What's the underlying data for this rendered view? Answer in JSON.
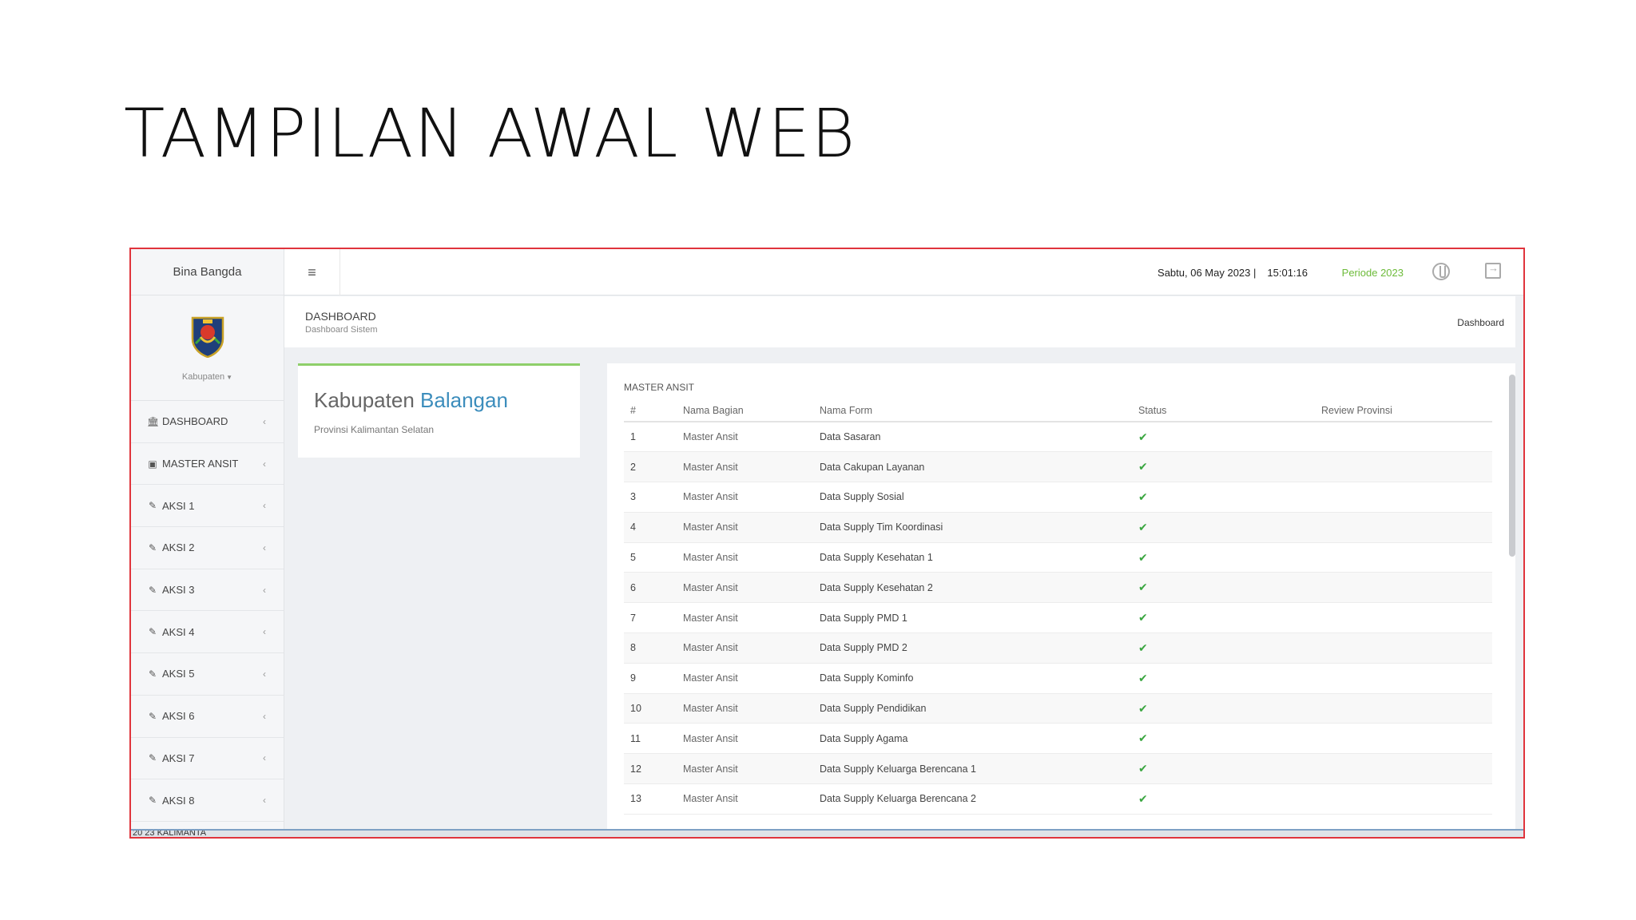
{
  "slide": {
    "title": "TAMPILAN AWAL WEB"
  },
  "sidebar": {
    "brand": "Bina Bangda",
    "profile_label": "Kabupaten",
    "items": [
      {
        "label": "DASHBOARD",
        "icon": "bank-icon"
      },
      {
        "label": "MASTER ANSIT",
        "icon": "book-icon"
      },
      {
        "label": "AKSI 1",
        "icon": "pencil-icon"
      },
      {
        "label": "AKSI 2",
        "icon": "pencil-icon"
      },
      {
        "label": "AKSI 3",
        "icon": "pencil-icon"
      },
      {
        "label": "AKSI 4",
        "icon": "pencil-icon"
      },
      {
        "label": "AKSI 5",
        "icon": "pencil-icon"
      },
      {
        "label": "AKSI 6",
        "icon": "pencil-icon"
      },
      {
        "label": "AKSI 7",
        "icon": "pencil-icon"
      },
      {
        "label": "AKSI 8",
        "icon": "pencil-icon"
      }
    ]
  },
  "topbar": {
    "date": "Sabtu, 06 May 2023 |",
    "time": "15:01:16",
    "periode": "Periode 2023",
    "periode_color": "#6dbb3a"
  },
  "pagehead": {
    "title": "DASHBOARD",
    "subtitle": "Dashboard Sistem",
    "breadcrumb": "Dashboard"
  },
  "kab_card": {
    "prefix": "Kabupaten",
    "highlight": "Balangan",
    "highlight_color": "#3c8dbc",
    "subtitle": "Provinsi Kalimantan Selatan"
  },
  "panel": {
    "title": "MASTER ANSIT",
    "headers": [
      "#",
      "Nama Bagian",
      "Nama Form",
      "Status",
      "Review Provinsi"
    ],
    "rows": [
      {
        "num": "1",
        "bagian": "Master Ansit",
        "form": "Data Sasaran",
        "status": "✔"
      },
      {
        "num": "2",
        "bagian": "Master Ansit",
        "form": "Data Cakupan Layanan",
        "status": "✔"
      },
      {
        "num": "3",
        "bagian": "Master Ansit",
        "form": "Data Supply Sosial",
        "status": "✔"
      },
      {
        "num": "4",
        "bagian": "Master Ansit",
        "form": "Data Supply Tim Koordinasi",
        "status": "✔"
      },
      {
        "num": "5",
        "bagian": "Master Ansit",
        "form": "Data Supply Kesehatan 1",
        "status": "✔"
      },
      {
        "num": "6",
        "bagian": "Master Ansit",
        "form": "Data Supply Kesehatan 2",
        "status": "✔"
      },
      {
        "num": "7",
        "bagian": "Master Ansit",
        "form": "Data Supply PMD 1",
        "status": "✔"
      },
      {
        "num": "8",
        "bagian": "Master Ansit",
        "form": "Data Supply PMD 2",
        "status": "✔"
      },
      {
        "num": "9",
        "bagian": "Master Ansit",
        "form": "Data Supply Kominfo",
        "status": "✔"
      },
      {
        "num": "10",
        "bagian": "Master Ansit",
        "form": "Data Supply Pendidikan",
        "status": "✔"
      },
      {
        "num": "11",
        "bagian": "Master Ansit",
        "form": "Data Supply Agama",
        "status": "✔"
      },
      {
        "num": "12",
        "bagian": "Master Ansit",
        "form": "Data Supply Keluarga Berencana 1",
        "status": "✔"
      },
      {
        "num": "13",
        "bagian": "Master Ansit",
        "form": "Data Supply Keluarga Berencana 2",
        "status": "✔"
      }
    ]
  },
  "bottom_strip": {
    "text": "20   23  KALIMANTA"
  }
}
